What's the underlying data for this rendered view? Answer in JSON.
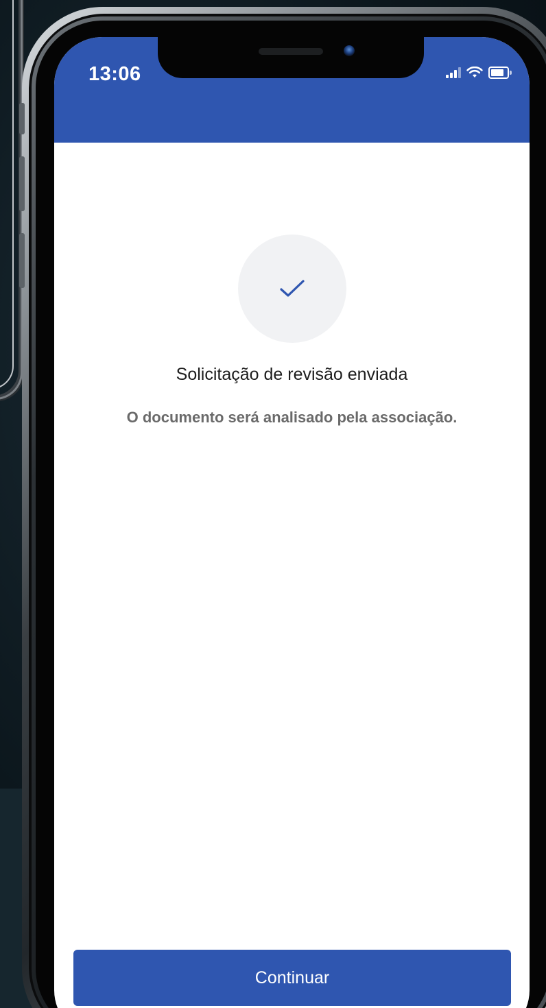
{
  "colors": {
    "brand": "#2f56b0",
    "check": "#2f56b0"
  },
  "status_bar": {
    "time": "13:06",
    "icons": [
      "signal-icon",
      "wifi-icon",
      "battery-icon"
    ]
  },
  "confirmation": {
    "icon": "checkmark-icon",
    "title": "Solicitação de revisão enviada",
    "message": "O documento será analisado pela associação."
  },
  "actions": {
    "continue_label": "Continuar"
  }
}
